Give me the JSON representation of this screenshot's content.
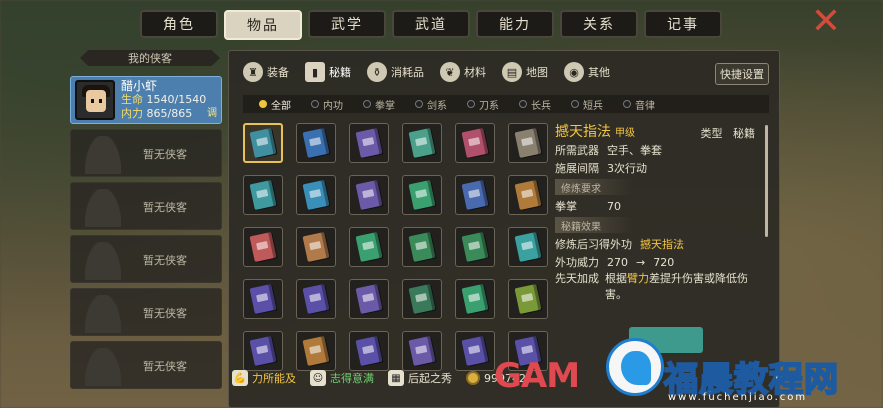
{
  "tabs": [
    {
      "label": "角色",
      "active": false
    },
    {
      "label": "物品",
      "active": true
    },
    {
      "label": "武学",
      "active": false
    },
    {
      "label": "武道",
      "active": false
    },
    {
      "label": "能力",
      "active": false
    },
    {
      "label": "关系",
      "active": false
    },
    {
      "label": "记事",
      "active": false
    }
  ],
  "close_icon": "close-x-icon",
  "sidebar": {
    "title": "我的侠客",
    "active_hero": {
      "name": "醋小虾",
      "hp_label": "生命",
      "hp_value": "1540/1540",
      "mp_label": "内力",
      "mp_value": "865/865",
      "tune_label": "调"
    },
    "empty_slots": [
      "暂无侠客",
      "暂无侠客",
      "暂无侠客",
      "暂无侠客",
      "暂无侠客"
    ]
  },
  "sub_tabs": [
    {
      "label": "装备",
      "icon": "armor-icon",
      "active": false
    },
    {
      "label": "秘籍",
      "icon": "book-icon",
      "active": true
    },
    {
      "label": "消耗品",
      "icon": "potion-icon",
      "active": false
    },
    {
      "label": "材料",
      "icon": "herb-icon",
      "active": false
    },
    {
      "label": "地图",
      "icon": "map-icon",
      "active": false
    },
    {
      "label": "其他",
      "icon": "lamp-icon",
      "active": false
    }
  ],
  "quick_setup_label": "快捷设置",
  "filters": [
    {
      "label": "全部",
      "active": true
    },
    {
      "label": "内功",
      "active": false
    },
    {
      "label": "拳掌",
      "active": false
    },
    {
      "label": "剑系",
      "active": false
    },
    {
      "label": "刀系",
      "active": false
    },
    {
      "label": "长兵",
      "active": false
    },
    {
      "label": "短兵",
      "active": false
    },
    {
      "label": "音律",
      "active": false
    }
  ],
  "books": [
    "#3f8fa0",
    "#3a6fb0",
    "#6a5aa8",
    "#4aa08a",
    "#b0506a",
    "#8a8070",
    "#3f9aa0",
    "#3a8fb8",
    "#6a5aa8",
    "#3aa070",
    "#4a6ab0",
    "#b07a3a",
    "#c05a5a",
    "#b07a4a",
    "#3aa070",
    "#3a8a5a",
    "#3a8a5a",
    "#3aa0a0",
    "#5a50a8",
    "#5a50a8",
    "#6a5aa8",
    "#3a7a5a",
    "#3aa070",
    "#7a9a3a",
    "#5a50a8",
    "#b07a3a",
    "#5a50a8",
    "#6a5aa8",
    "#5a50a8",
    "#5a50a8"
  ],
  "details": {
    "name": "撼天指法",
    "grade": "甲级",
    "type_label": "类型",
    "type_value": "秘籍",
    "weapon_label": "所需武器",
    "weapon_value": "空手、拳套",
    "interval_label": "施展间隔",
    "interval_value": "3次行动",
    "req_section": "修炼要求",
    "req_stat": "拳掌",
    "req_value": "70",
    "effect_section": "秘籍效果",
    "learn_label": "修炼后习得外功",
    "learn_value": "撼天指法",
    "power_label": "外功威力",
    "power_from": "270",
    "power_to": "720",
    "innate_label": "先天加成",
    "innate_pre": "根据",
    "innate_hl": "臂力",
    "innate_post": "差提升伤害或降低伤害。",
    "arrow": "→"
  },
  "bottom": {
    "ability_label": "力所能及",
    "mood_label": "志得意满",
    "mood_color": "#6fd06f",
    "rise_label": "后起之秀",
    "coin_value": "999742"
  },
  "watermark": {
    "gam": "GAM",
    "text": "福晨教程网",
    "url": "www.fuchenjiao.com"
  }
}
